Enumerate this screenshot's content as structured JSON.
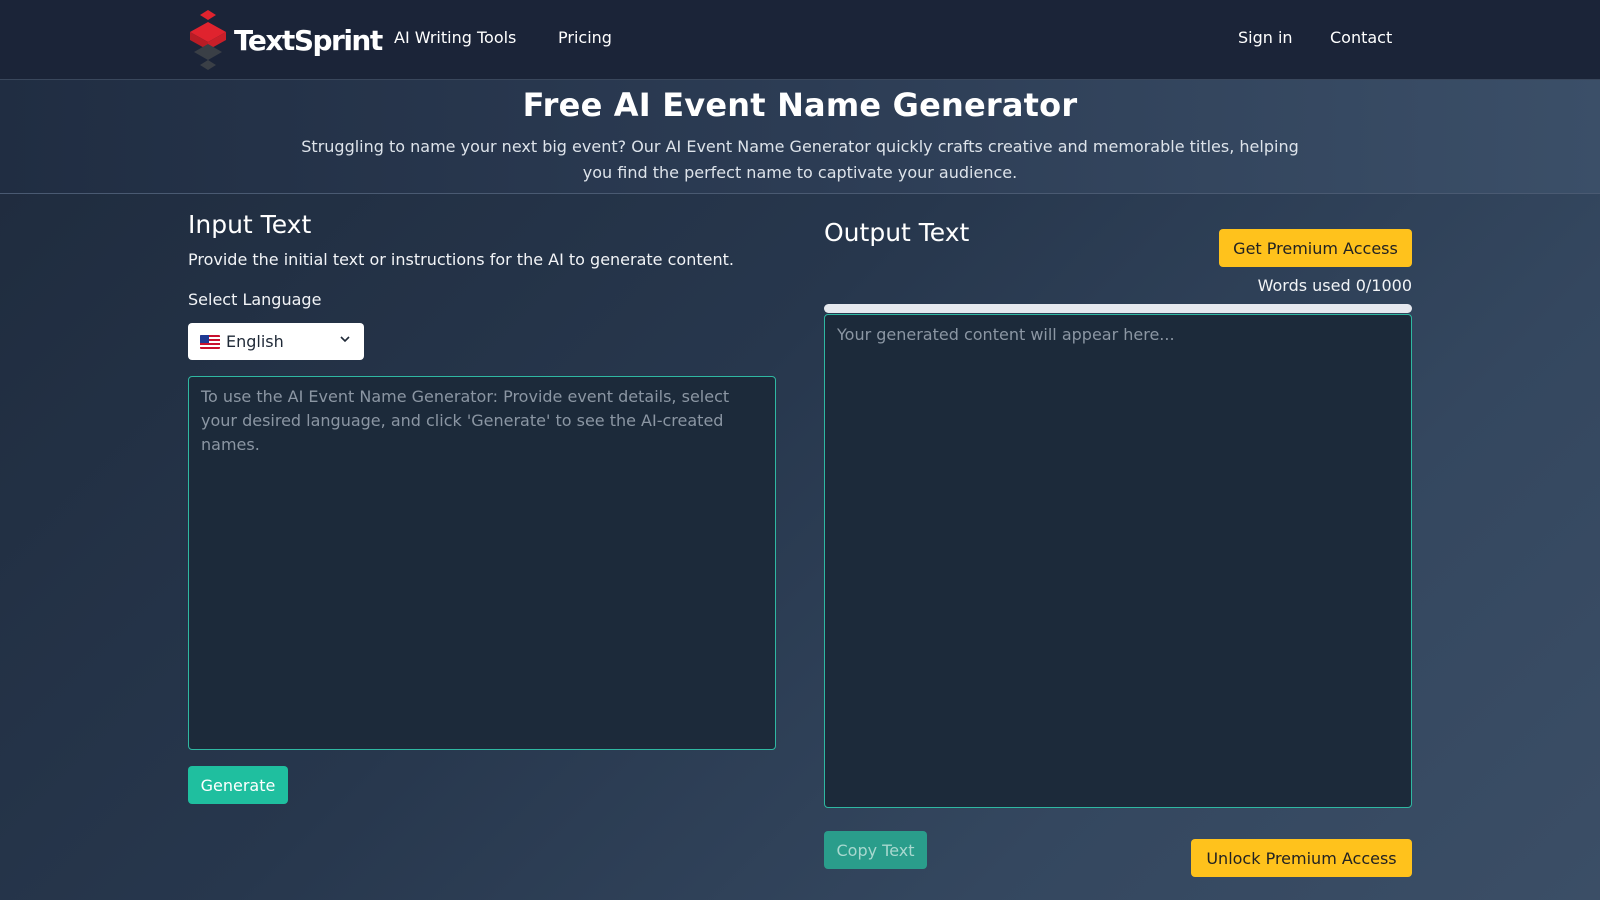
{
  "brand": {
    "name": "TextSprint"
  },
  "nav": {
    "tools": "AI Writing Tools",
    "pricing": "Pricing",
    "signin": "Sign in",
    "contact": "Contact"
  },
  "hero": {
    "title": "Free AI Event Name Generator",
    "subtitle": "Struggling to name your next big event? Our AI Event Name Generator quickly crafts creative and memorable titles, helping you find the perfect name to captivate your audience."
  },
  "input_panel": {
    "title": "Input Text",
    "description": "Provide the initial text or instructions for the AI to generate content.",
    "language_label": "Select Language",
    "language_value": "English",
    "language_flag": "us-flag-icon",
    "placeholder": "To use the AI Event Name Generator: Provide event details, select your desired language, and click 'Generate' to see the AI-created names.",
    "value": "",
    "generate_label": "Generate"
  },
  "output_panel": {
    "title": "Output Text",
    "premium_label": "Get Premium Access",
    "words_used": "Words used 0/1000",
    "words_progress": 0,
    "placeholder": "Your generated content will appear here...",
    "value": "",
    "copy_label": "Copy Text",
    "unlock_label": "Unlock Premium Access"
  },
  "colors": {
    "accent_teal": "#1fbf9f",
    "accent_gold": "#ffc21c",
    "logo_red": "#e0232e",
    "header_bg": "#1b2438"
  }
}
